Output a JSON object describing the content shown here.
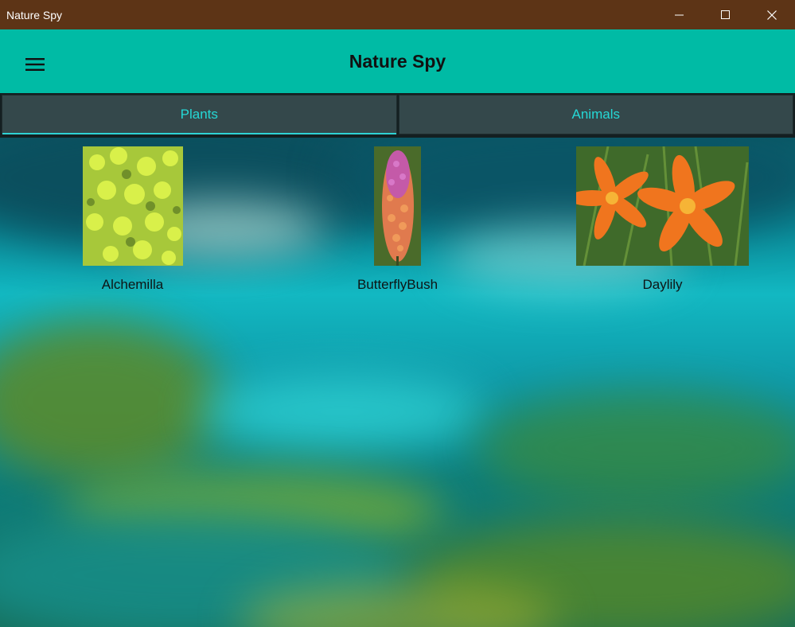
{
  "window": {
    "title": "Nature Spy"
  },
  "app": {
    "title": "Nature Spy"
  },
  "tabs": [
    {
      "label": "Plants",
      "selected": true
    },
    {
      "label": "Animals",
      "selected": false
    }
  ],
  "items": [
    {
      "label": "Alchemilla",
      "icon": "alchemilla-photo"
    },
    {
      "label": "ButterflyBush",
      "icon": "butterfly-bush-photo"
    },
    {
      "label": "Daylily",
      "icon": "daylily-photo"
    }
  ],
  "colors": {
    "titlebar": "#5d3416",
    "appbar": "#00bba5",
    "tab_text": "#25d8d6",
    "tab_bg": "#34484b"
  }
}
